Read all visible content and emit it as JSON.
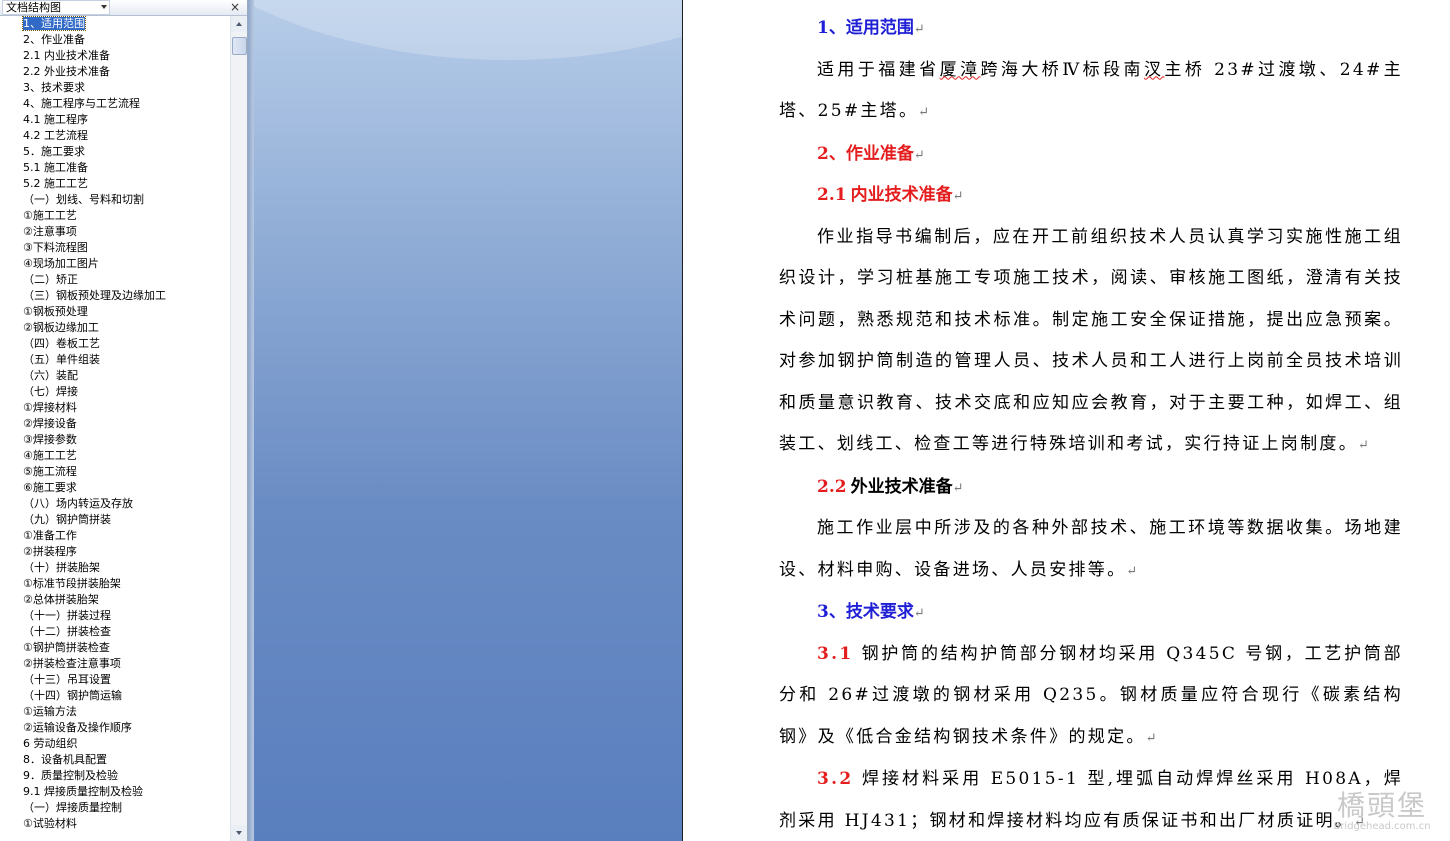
{
  "doc_map": {
    "title": "文档结构图",
    "close_glyph": "×",
    "items": [
      "1、适用范围",
      "2、作业准备",
      "2.1 内业技术准备",
      "2.2 外业技术准备",
      "3、技术要求",
      "4、施工程序与工艺流程",
      "4.1 施工程序",
      "4.2 工艺流程",
      "5．施工要求",
      "5.1 施工准备",
      "5.2 施工工艺",
      "（一）划线、号料和切割",
      "①施工工艺",
      "②注意事项",
      "③下料流程图",
      "④现场加工图片",
      "（二）矫正",
      "（三）钢板预处理及边缘加工",
      "①钢板预处理",
      "②钢板边缘加工",
      "（四）卷板工艺",
      "（五）单件组装",
      "（六）装配",
      "（七）焊接",
      "①焊接材料",
      "②焊接设备",
      "③焊接参数",
      "④施工工艺",
      "⑤施工流程",
      "⑥施工要求",
      "（八）场内转运及存放",
      "（九）钢护筒拼装",
      "①准备工作",
      "②拼装程序",
      "（十）拼装胎架",
      "①标准节段拼装胎架",
      "②总体拼装胎架",
      "（十一）拼装过程",
      "（十二）拼装检查",
      "①钢护筒拼装检查",
      "②拼装检查注意事项",
      "（十三）吊耳设置",
      "（十四）钢护筒运输",
      "①运输方法",
      "②运输设备及操作顺序",
      "6 劳动组织",
      "8．设备机具配置",
      "9．质量控制及检验",
      "9.1 焊接质量控制及检验",
      "（一）焊接质量控制",
      "①试验材料"
    ]
  },
  "document": {
    "h1": {
      "text": "1、适用范围"
    },
    "p1_a": "适用于福建省",
    "p1_squig": "厦漳",
    "p1_b": "跨海大桥Ⅳ标段南",
    "p1_squig2": "汊",
    "p1_c": "主桥  23#过渡墩、24#主塔、25#主塔。",
    "h2": {
      "text": "2、作业准备"
    },
    "h21": {
      "num": "2.1",
      "text": "内业技术准备"
    },
    "p21": "作业指导书编制后，应在开工前组织技术人员认真学习实施性施工组织设计，学习桩基施工专项施工技术，阅读、审核施工图纸，澄清有关技术问题，熟悉规范和技术标准。制定施工安全保证措施，提出应急预案。对参加钢护筒制造的管理人员、技术人员和工人进行上岗前全员技术培训和质量意识教育、技术交底和应知应会教育，对于主要工种，如焊工、组装工、划线工、检查工等进行特殊培训和考试，实行持证上岗制度。",
    "h22": {
      "num": "2.2",
      "text": "外业技术准备"
    },
    "p22": "施工作业层中所涉及的各种外部技术、施工环境等数据收集。场地建设、材料申购、设备进场、人员安排等。",
    "h3": {
      "text": "3、技术要求"
    },
    "p31": {
      "num": "3.1",
      "text": "钢护筒的结构护筒部分钢材均采用 Q345C 号钢，工艺护筒部分和 26#过渡墩的钢材采用 Q235。钢材质量应符合现行《碳素结构钢》及《低合金结构钢技术条件》的规定。"
    },
    "p32": {
      "num": "3.2",
      "text": "焊接材料采用 E5015-1 型,埋弧自动焊焊丝采用 H08A，焊剂采用 HJ431；钢材和焊接材料均应有质保证书和出厂材质证明。"
    },
    "para_mark": "↵"
  },
  "watermark": {
    "logo": "橋頭堡",
    "url": "Bridgehead.com.cn"
  },
  "colors": {
    "heading_blue": "#1f1fd6",
    "heading_red": "#e41e1e",
    "selection": "#3169c6"
  }
}
